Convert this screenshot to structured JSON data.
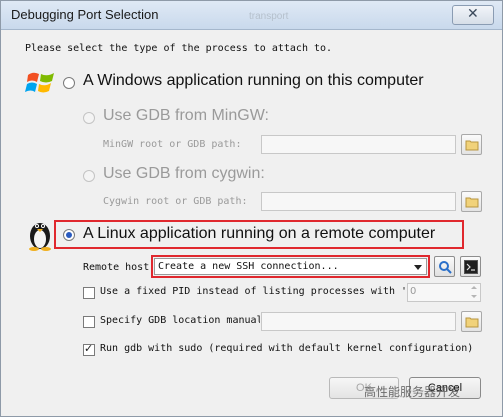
{
  "window": {
    "title": "Debugging Port Selection",
    "ghost_text": "transport",
    "close_glyph": "✕"
  },
  "instruction": "Please select the type of the process to attach to.",
  "windows_option": {
    "label": "A Windows application running on this computer",
    "selected": false,
    "mingw": {
      "label": "Use GDB from MinGW:",
      "path_label": "MinGW root or GDB path:",
      "path_value": ""
    },
    "cygwin": {
      "label": "Use GDB from cygwin:",
      "path_label": "Cygwin root or GDB path:",
      "path_value": ""
    }
  },
  "linux_option": {
    "label": "A Linux application running on a remote computer",
    "selected": true,
    "remote_host_label": "Remote host:",
    "remote_host_value": "Create a new SSH connection...",
    "fixed_pid": {
      "label": "Use a fixed PID instead of listing processes with 'ps'",
      "checked": false,
      "value": "0"
    },
    "gdb_location": {
      "label": "Specify GDB location manually",
      "checked": false,
      "value": ""
    },
    "sudo": {
      "label": "Run gdb with sudo (required with default kernel configuration)",
      "checked": true
    }
  },
  "buttons": {
    "ok": "OK",
    "cancel": "Cancel"
  },
  "watermark": "高性能服务器开发",
  "colors": {
    "highlight": "#e0282e",
    "radio_selected": "#2a5bbf",
    "title_bar": "#c9d9ec"
  },
  "icons": [
    "windows-logo-icon",
    "linux-tux-icon",
    "folder-icon",
    "search-icon",
    "terminal-icon",
    "close-icon"
  ]
}
